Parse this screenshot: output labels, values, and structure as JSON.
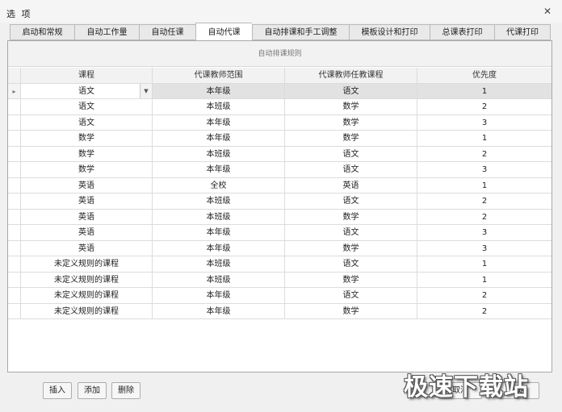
{
  "window": {
    "title": "选 项",
    "close_icon": "✕"
  },
  "tabs": [
    "启动和常规",
    "自动工作量",
    "自动任课",
    "自动代课",
    "自动排课和手工调整",
    "模板设计和打印",
    "总课表打印",
    "代课打印"
  ],
  "active_tab": 3,
  "panel": {
    "group_header": "自动排课规则"
  },
  "grid": {
    "columns": [
      "课程",
      "代课教师范围",
      "代课教师任教课程",
      "优先度"
    ],
    "row_indicator": "▸",
    "dropdown_icon": "▼",
    "rows": [
      [
        "语文",
        "本年级",
        "语文",
        "1"
      ],
      [
        "语文",
        "本班级",
        "数学",
        "2"
      ],
      [
        "语文",
        "本年级",
        "数学",
        "3"
      ],
      [
        "数学",
        "本年级",
        "数学",
        "1"
      ],
      [
        "数学",
        "本班级",
        "语文",
        "2"
      ],
      [
        "数学",
        "本年级",
        "语文",
        "3"
      ],
      [
        "英语",
        "全校",
        "英语",
        "1"
      ],
      [
        "英语",
        "本班级",
        "语文",
        "2"
      ],
      [
        "英语",
        "本班级",
        "数学",
        "2"
      ],
      [
        "英语",
        "本年级",
        "语文",
        "3"
      ],
      [
        "英语",
        "本年级",
        "数学",
        "3"
      ],
      [
        "未定义规则的课程",
        "本班级",
        "语文",
        "1"
      ],
      [
        "未定义规则的课程",
        "本班级",
        "数学",
        "1"
      ],
      [
        "未定义规则的课程",
        "本年级",
        "语文",
        "2"
      ],
      [
        "未定义规则的课程",
        "本年级",
        "数学",
        "2"
      ]
    ]
  },
  "buttons": {
    "insert": "插入",
    "add": "添加",
    "delete": "删除",
    "cancel": "取消",
    "ok": "确定"
  },
  "watermark": "极速下载站"
}
